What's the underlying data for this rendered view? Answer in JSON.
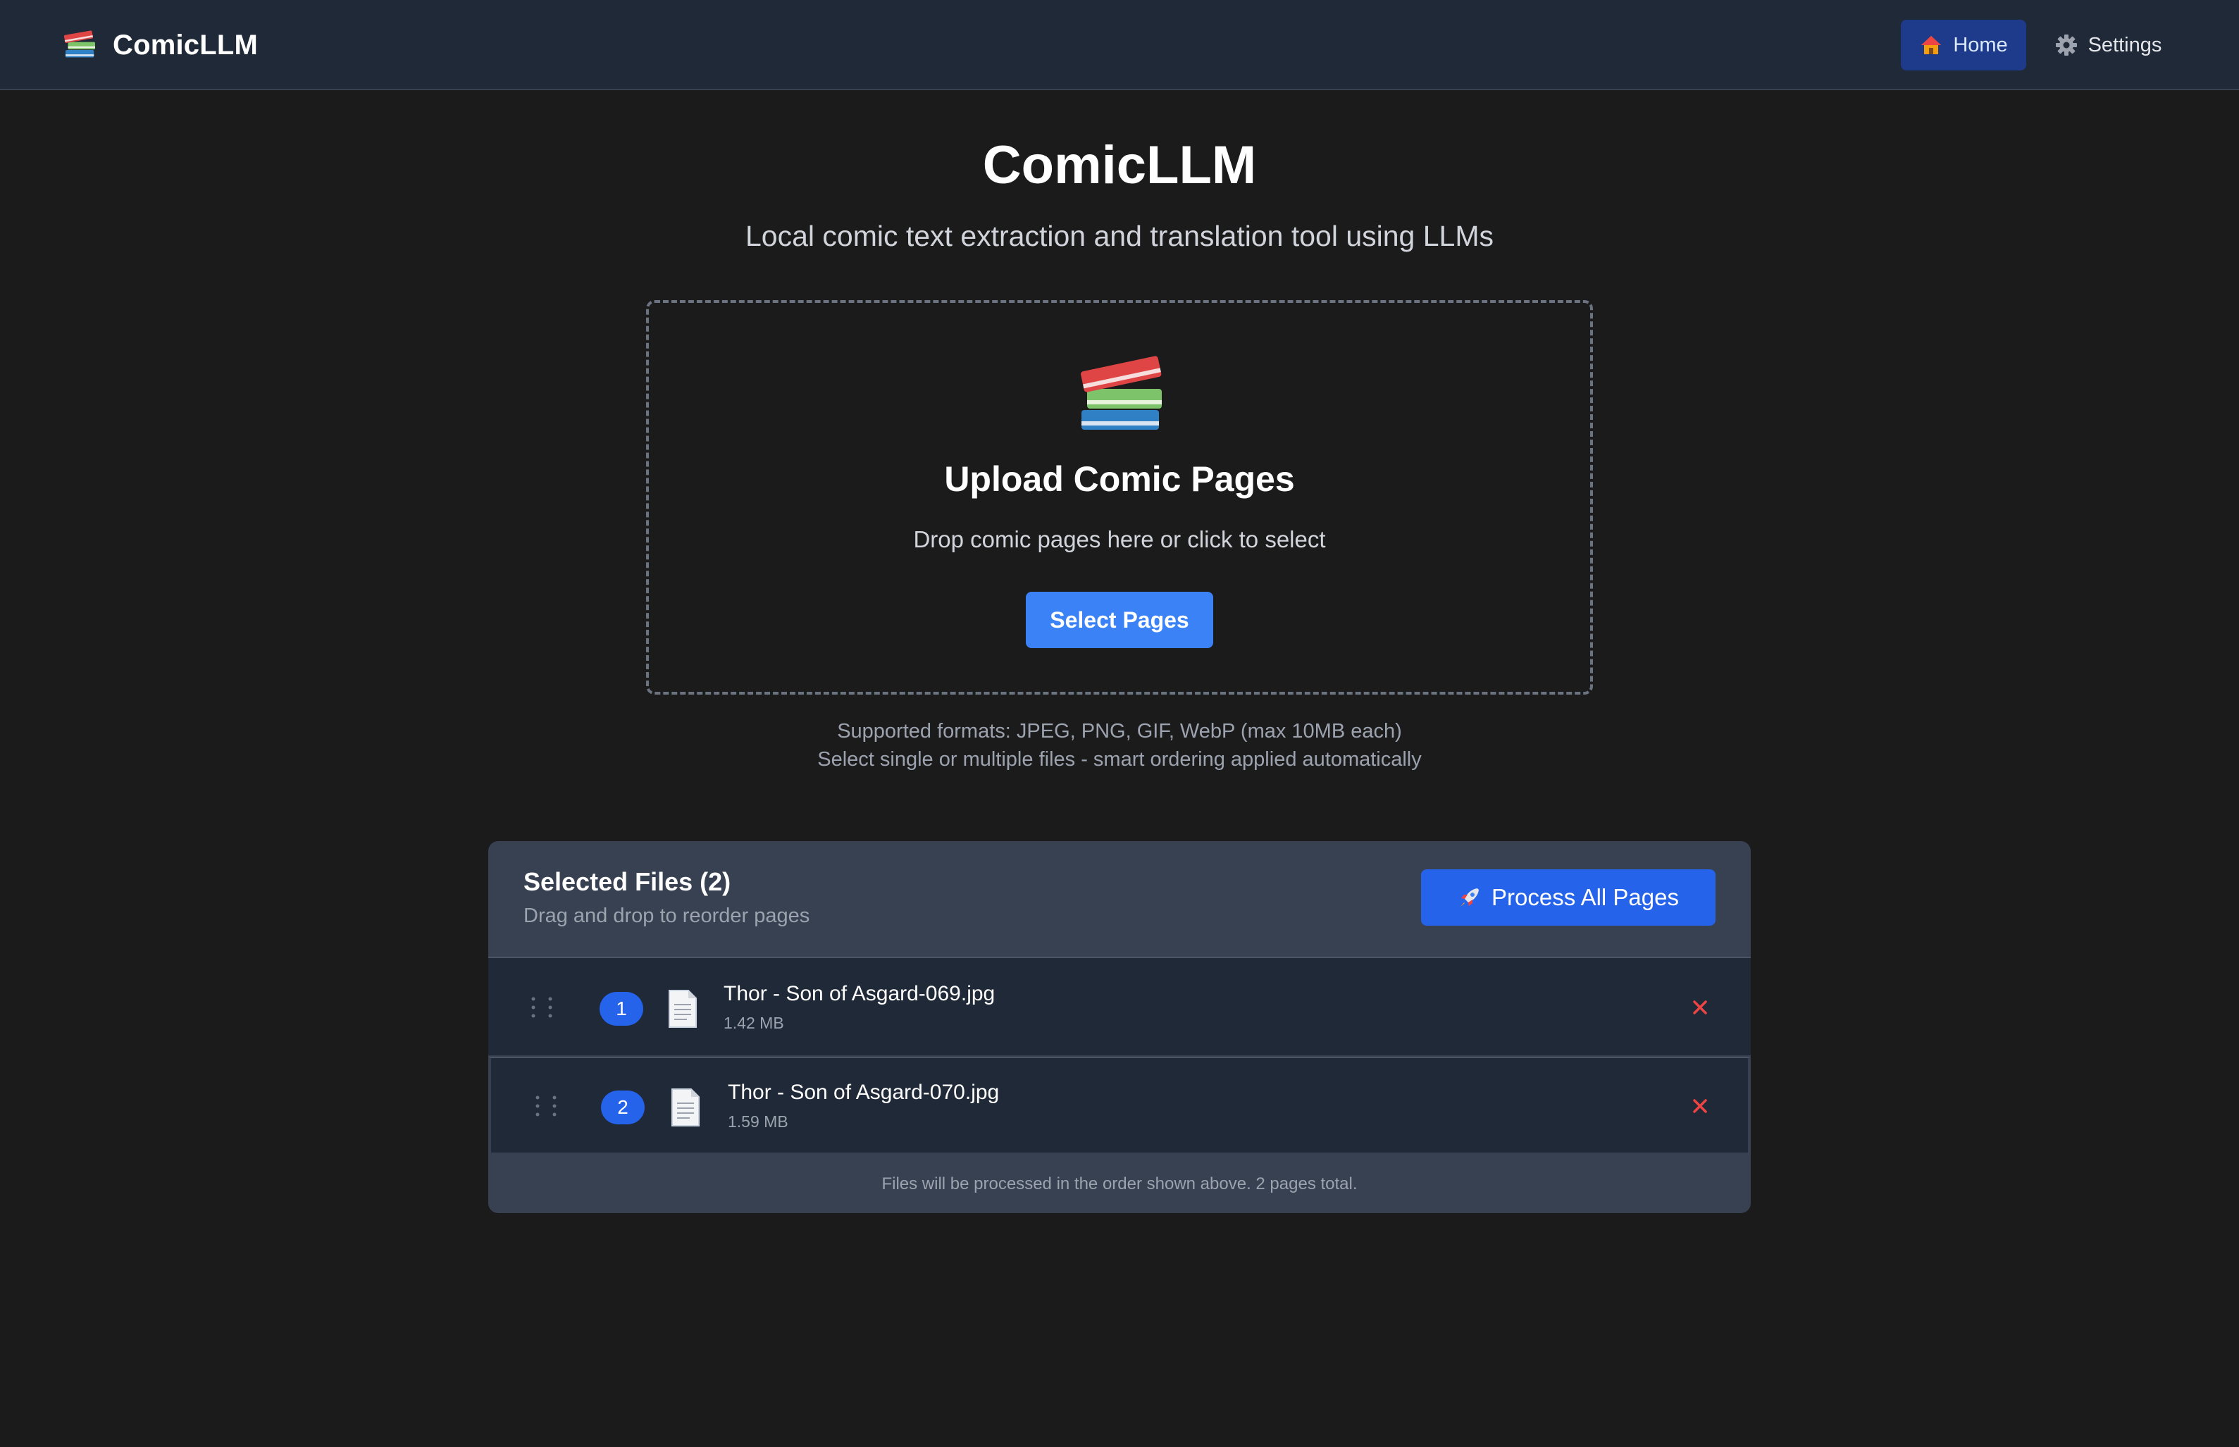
{
  "nav": {
    "brand_icon": "books-icon",
    "brand_name": "ComicLLM",
    "items": [
      {
        "label": "Home",
        "icon": "house-icon",
        "active": true
      },
      {
        "label": "Settings",
        "icon": "gear-icon",
        "active": false
      }
    ]
  },
  "hero": {
    "title": "ComicLLM",
    "subtitle": "Local comic text extraction and translation tool using LLMs"
  },
  "dropzone": {
    "icon": "books-icon",
    "title": "Upload Comic Pages",
    "hint": "Drop comic pages here or click to select",
    "button_label": "Select Pages"
  },
  "formats_note": {
    "line1": "Supported formats: JPEG, PNG, GIF, WebP (max 10MB each)",
    "line2": "Select single or multiple files - smart ordering applied automatically"
  },
  "files_panel": {
    "title": "Selected Files (2)",
    "subtitle": "Drag and drop to reorder pages",
    "process_button": {
      "icon": "rocket-icon",
      "label": "Process All Pages"
    },
    "files": [
      {
        "index": "1",
        "name": "Thor - Son of Asgard-069.jpg",
        "size": "1.42 MB"
      },
      {
        "index": "2",
        "name": "Thor - Son of Asgard-070.jpg",
        "size": "1.59 MB"
      }
    ],
    "footer": "Files will be processed in the order shown above. 2 pages total."
  },
  "colors": {
    "background": "#1b1b1c",
    "nav_background": "#1f2937",
    "panel_background": "#374151",
    "accent": "#2563eb",
    "select_button": "#3b82f6",
    "remove": "#ef4444"
  }
}
